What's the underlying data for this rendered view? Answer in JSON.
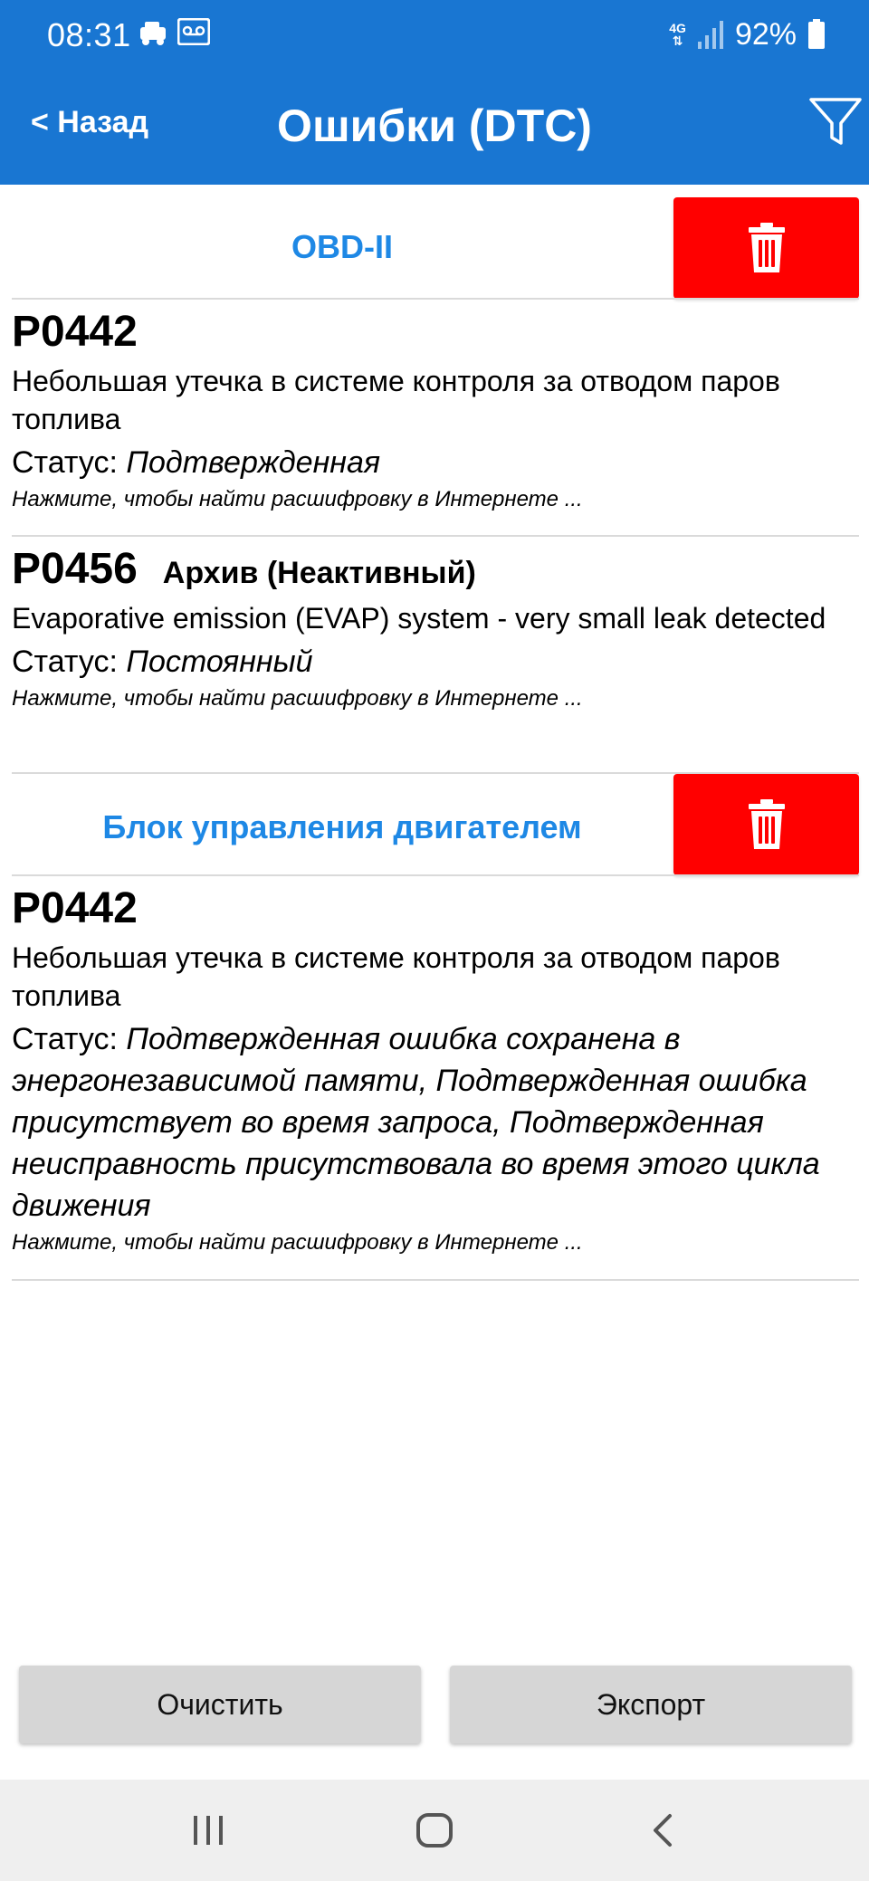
{
  "status_bar": {
    "time": "08:31",
    "network": "4G",
    "battery": "92%"
  },
  "app_bar": {
    "back_label": "< Назад",
    "title": "Ошибки (DTC)"
  },
  "sections": [
    {
      "title": "OBD-II",
      "entries": [
        {
          "code": "P0442",
          "archive": "",
          "description": "Небольшая утечка в системе контроля за отводом паров топлива",
          "status_label": "Статус:",
          "status_value": "Подтвержденная",
          "hint": "Нажмите, чтобы найти расшифровку в Интернете ..."
        },
        {
          "code": "P0456",
          "archive": "Архив (Неактивный)",
          "description": "Evaporative emission (EVAP) system - very small leak detected",
          "status_label": "Статус:",
          "status_value": "Постоянный",
          "hint": "Нажмите, чтобы найти расшифровку в Интернете ..."
        }
      ]
    },
    {
      "title": "Блок управления двигателем",
      "entries": [
        {
          "code": "P0442",
          "archive": "",
          "description": "Небольшая утечка в системе контроля за отводом паров топлива",
          "status_label": "Статус:",
          "status_value": "Подтвержденная ошибка сохранена в энергонезависимой памяти, Подтвержденная ошибка присутствует во время запроса, Подтвержденная неисправность присутствовала во время этого цикла движения",
          "hint": "Нажмите, чтобы найти расшифровку в Интернете ..."
        }
      ]
    }
  ],
  "buttons": {
    "clear": "Очистить",
    "export": "Экспорт"
  },
  "colors": {
    "app_bar": "#1976d2",
    "section_title": "#1e88e5",
    "delete_button": "#ff0000"
  },
  "icons": [
    "car-icon",
    "voicemail-icon",
    "signal-icon",
    "battery-icon",
    "filter-icon",
    "trash-icon",
    "recents-icon",
    "home-icon",
    "back-icon"
  ]
}
